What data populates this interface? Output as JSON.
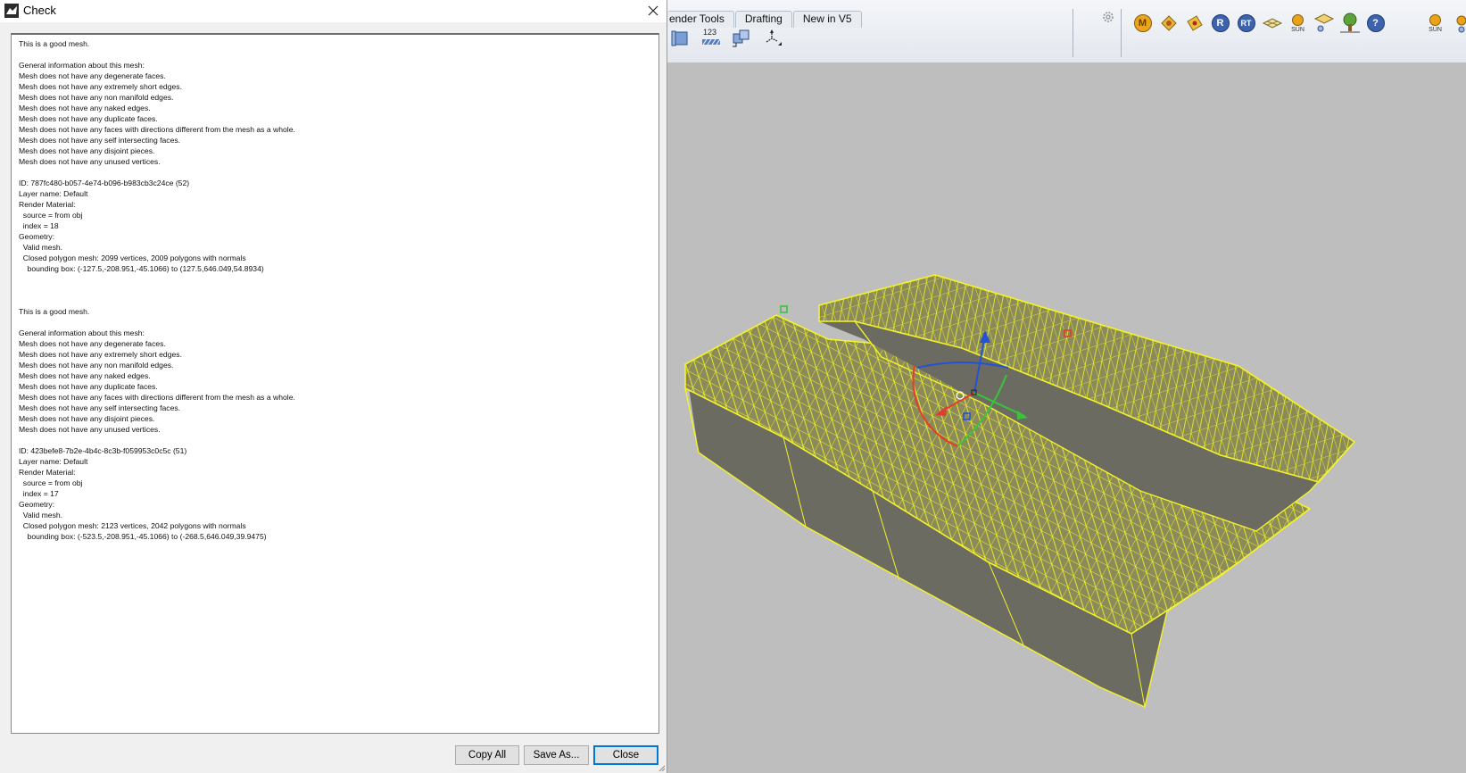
{
  "dialog": {
    "title": "Check",
    "report_text": "This is a good mesh.\n\nGeneral information about this mesh:\nMesh does not have any degenerate faces.\nMesh does not have any extremely short edges.\nMesh does not have any non manifold edges.\nMesh does not have any naked edges.\nMesh does not have any duplicate faces.\nMesh does not have any faces with directions different from the mesh as a whole.\nMesh does not have any self intersecting faces.\nMesh does not have any disjoint pieces.\nMesh does not have any unused vertices.\n\nID: 787fc480-b057-4e74-b096-b983cb3c24ce (52)\nLayer name: Default\nRender Material:\n  source = from obj\n  index = 18\nGeometry:\n  Valid mesh.\n  Closed polygon mesh: 2099 vertices, 2009 polygons with normals\n    bounding box: (-127.5,-208.951,-45.1066) to (127.5,646.049,54.8934)\n\n\n\nThis is a good mesh.\n\nGeneral information about this mesh:\nMesh does not have any degenerate faces.\nMesh does not have any extremely short edges.\nMesh does not have any non manifold edges.\nMesh does not have any naked edges.\nMesh does not have any duplicate faces.\nMesh does not have any faces with directions different from the mesh as a whole.\nMesh does not have any self intersecting faces.\nMesh does not have any disjoint pieces.\nMesh does not have any unused vertices.\n\nID: 423befe8-7b2e-4b4c-8c3b-f059953c0c5c (51)\nLayer name: Default\nRender Material:\n  source = from obj\n  index = 17\nGeometry:\n  Valid mesh.\n  Closed polygon mesh: 2123 vertices, 2042 polygons with normals\n    bounding box: (-523.5,-208.951,-45.1066) to (-268.5,646.049,39.9475)",
    "buttons": {
      "copy_all": "Copy All",
      "save_as": "Save As...",
      "close": "Close"
    }
  },
  "toolbar": {
    "tabs": [
      "ender Tools",
      "Drafting",
      "New in V5"
    ],
    "tool_123_label": "123",
    "render_icons": [
      {
        "name": "material-icon",
        "letter": "M",
        "color": "#e8a416"
      },
      {
        "name": "texture-icon",
        "letter": "",
        "color": "#e0b030"
      },
      {
        "name": "decal-icon",
        "letter": "",
        "color": "#e0b030"
      },
      {
        "name": "render-icon",
        "letter": "R",
        "color": "#3b5fa8"
      },
      {
        "name": "raytrace-icon",
        "letter": "RT",
        "color": "#3b5fa8"
      }
    ],
    "sun_label": "SUN",
    "sun_label_2": "SUN"
  },
  "colors": {
    "mesh_wire": "#f3f32a",
    "mesh_side": "#6b6b62",
    "viewport_bg": "#bebebe",
    "gumball_x": "#e53b2b",
    "gumball_y": "#3bc43b",
    "gumball_z": "#2452d6"
  }
}
